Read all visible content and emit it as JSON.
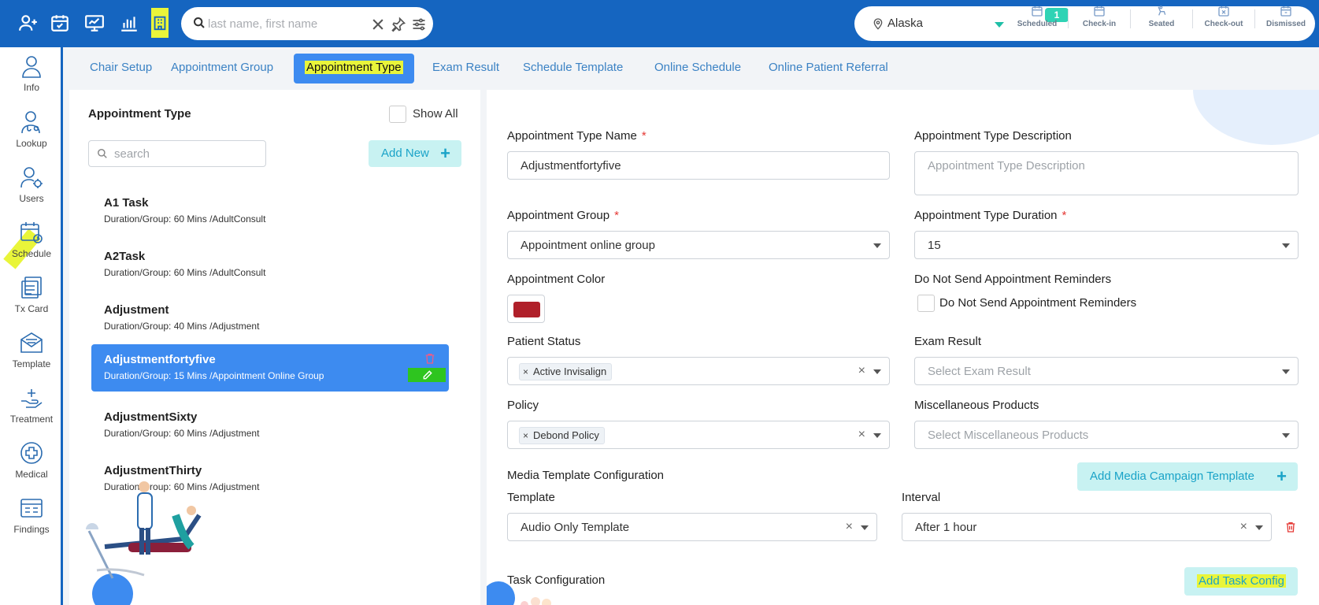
{
  "header": {
    "icons": [
      "add-patient-icon",
      "calendar-check-icon",
      "monitor-report-icon",
      "bar-chart-icon",
      "building-icon"
    ],
    "search": {
      "placeholder": "last name, first name"
    },
    "location": {
      "name": "Alaska"
    },
    "statuses": [
      {
        "label": "Scheduled",
        "icon": "calendar-icon",
        "count": "1"
      },
      {
        "label": "Check-in",
        "icon": "check-in-icon"
      },
      {
        "label": "Seated",
        "icon": "seated-icon"
      },
      {
        "label": "Check-out",
        "icon": "check-out-icon"
      },
      {
        "label": "Dismissed",
        "icon": "dismissed-icon"
      }
    ]
  },
  "sidebar": {
    "items": [
      {
        "label": "Info",
        "icon": "person-icon"
      },
      {
        "label": "Lookup",
        "icon": "doctor-icon"
      },
      {
        "label": "Users",
        "icon": "users-gear-icon"
      },
      {
        "label": "Schedule",
        "icon": "schedule-icon"
      },
      {
        "label": "Tx Card",
        "icon": "tx-card-icon"
      },
      {
        "label": "Template",
        "icon": "template-icon"
      },
      {
        "label": "Treatment",
        "icon": "treatment-icon"
      },
      {
        "label": "Medical",
        "icon": "medical-icon"
      },
      {
        "label": "Findings",
        "icon": "findings-icon"
      }
    ]
  },
  "tabs": [
    {
      "label": "Chair Setup"
    },
    {
      "label": "Appointment Group"
    },
    {
      "label": "Appointment Type",
      "active": true
    },
    {
      "label": "Exam Result"
    },
    {
      "label": "Schedule Template"
    },
    {
      "label": "Online Schedule"
    },
    {
      "label": "Online Patient Referral"
    }
  ],
  "list_panel": {
    "title": "Appointment Type",
    "show_all_label": "Show All",
    "search_placeholder": "search",
    "add_new_label": "Add New",
    "items": [
      {
        "name": "A1 Task",
        "detail": "Duration/Group: 60 Mins /AdultConsult"
      },
      {
        "name": "A2Task",
        "detail": "Duration/Group: 60 Mins /AdultConsult"
      },
      {
        "name": "Adjustment",
        "detail": "Duration/Group: 40 Mins /Adjustment"
      },
      {
        "name": "Adjustmentfortyfive",
        "detail": "Duration/Group: 15 Mins /Appointment Online Group",
        "selected": true
      },
      {
        "name": "AdjustmentSixty",
        "detail": "Duration/Group: 60 Mins /Adjustment"
      },
      {
        "name": "AdjustmentThirty",
        "detail": "Duration/Group: 60 Mins /Adjustment"
      }
    ]
  },
  "form": {
    "type_name": {
      "label": "Appointment Type Name",
      "value": "Adjustmentfortyfive"
    },
    "description": {
      "label": "Appointment Type Description",
      "placeholder": "Appointment Type Description"
    },
    "group": {
      "label": "Appointment Group",
      "value": "Appointment online group"
    },
    "duration": {
      "label": "Appointment Type Duration",
      "value": "15"
    },
    "color": {
      "label": "Appointment Color",
      "value": "#b0202a"
    },
    "reminders": {
      "label": "Do Not Send Appointment Reminders",
      "checkbox_label": "Do Not Send Appointment Reminders"
    },
    "patient_status": {
      "label": "Patient Status",
      "chip": "Active Invisalign"
    },
    "exam_result": {
      "label": "Exam Result",
      "placeholder": "Select Exam Result"
    },
    "policy": {
      "label": "Policy",
      "chip": "Debond Policy"
    },
    "misc_products": {
      "label": "Miscellaneous Products",
      "placeholder": "Select Miscellaneous Products"
    },
    "media": {
      "section_label": "Media Template Configuration",
      "add_label": "Add Media Campaign Template",
      "template_label": "Template",
      "template_value": "Audio Only Template",
      "interval_label": "Interval",
      "interval_value": "After 1 hour"
    },
    "task": {
      "section_label": "Task Configuration",
      "add_label": "Add Task Config"
    }
  }
}
